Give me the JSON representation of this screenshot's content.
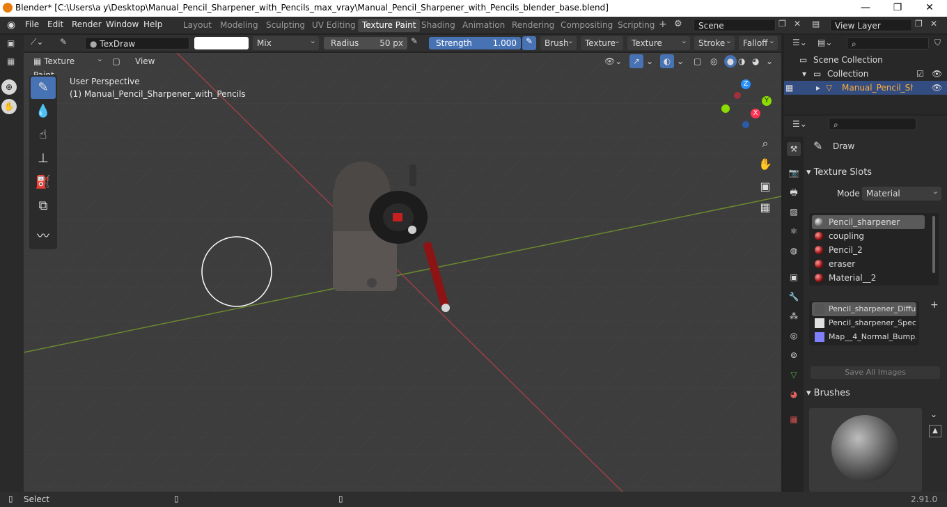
{
  "window": {
    "title": "Blender* [C:\\Users\\a y\\Desktop\\Manual_Pencil_Sharpener_with_Pencils_max_vray\\Manual_Pencil_Sharpener_with_Pencils_blender_base.blend]"
  },
  "menu": [
    "File",
    "Edit",
    "Render",
    "Window",
    "Help"
  ],
  "workspaces": [
    "Layout",
    "Modeling",
    "Sculpting",
    "UV Editing",
    "Texture Paint",
    "Shading",
    "Animation",
    "Rendering",
    "Compositing",
    "Scripting"
  ],
  "active_workspace": "Texture Paint",
  "scene": "Scene",
  "view_layer": "View Layer",
  "tool_header": {
    "brush_name": "TexDraw",
    "blend": "Mix",
    "radius_label": "Radius",
    "radius_value": "50 px",
    "strength_label": "Strength",
    "strength_value": "1.000",
    "brush": "Brush",
    "texture": "Texture",
    "texture_mask": "Texture Mask",
    "stroke": "Stroke",
    "falloff": "Falloff"
  },
  "viewport_header": {
    "mode": "Texture Paint",
    "view": "View"
  },
  "viewport": {
    "perspective": "User Perspective",
    "object_label": "(1) Manual_Pencil_Sharpener_with_Pencils",
    "gizmo": {
      "z": "Z",
      "y": "Y",
      "x": "X"
    }
  },
  "outliner": {
    "scene_collection": "Scene Collection",
    "collection": "Collection",
    "object": "Manual_Pencil_Sharp"
  },
  "properties": {
    "tool_name": "Draw",
    "texture_slots_title": "Texture Slots",
    "mode_label": "Mode",
    "mode_value": "Material",
    "materials": [
      "Pencil_sharpener",
      "coupling",
      "Pencil_2",
      "eraser",
      "Material__2"
    ],
    "images": [
      "Pencil_sharpener_Diffus...",
      "Pencil_sharpener_Spec....",
      "Map__4_Normal_Bump...."
    ],
    "save_all": "Save All Images",
    "brushes_title": "Brushes"
  },
  "status": {
    "select": "Select",
    "version": "2.91.0"
  },
  "colors": {
    "accent": "#4772b3",
    "x_axis": "#ff3352",
    "y_axis": "#8bdc00",
    "z_axis": "#2890ff"
  }
}
